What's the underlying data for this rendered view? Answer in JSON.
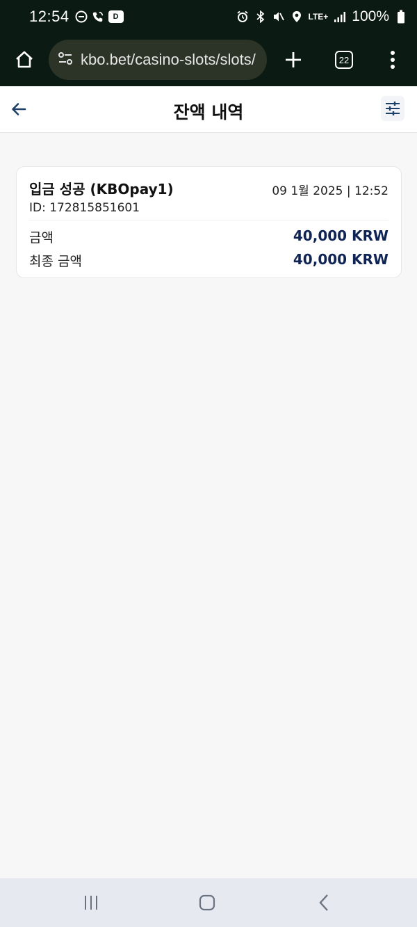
{
  "status_bar": {
    "time": "12:54",
    "left_icons": [
      "do-not-disturb-icon",
      "wifi-call-icon",
      "notification-app-icon"
    ],
    "app_badge": "D",
    "right_icons": [
      "alarm-icon",
      "bluetooth-icon",
      "mute-icon",
      "location-icon"
    ],
    "network": "LTE+",
    "battery": "100%"
  },
  "browser": {
    "url": "kbo.bet/casino-slots/slots/",
    "tab_count": "22"
  },
  "header": {
    "title": "잔액 내역"
  },
  "transaction": {
    "title": "입금 성공 (KBOpay1)",
    "date": "09 1월 2025 | 12:52",
    "id": "ID: 172815851601",
    "rows": [
      {
        "label": "금액",
        "value": "40,000 KRW"
      },
      {
        "label": "최종 금액",
        "value": "40,000 KRW"
      }
    ]
  },
  "colors": {
    "status_bg": "#0b1a12",
    "url_pill": "#2b3427",
    "amount": "#0f2454",
    "page_bg": "#f7f7f7",
    "nav_bg": "#e6eaf0"
  }
}
